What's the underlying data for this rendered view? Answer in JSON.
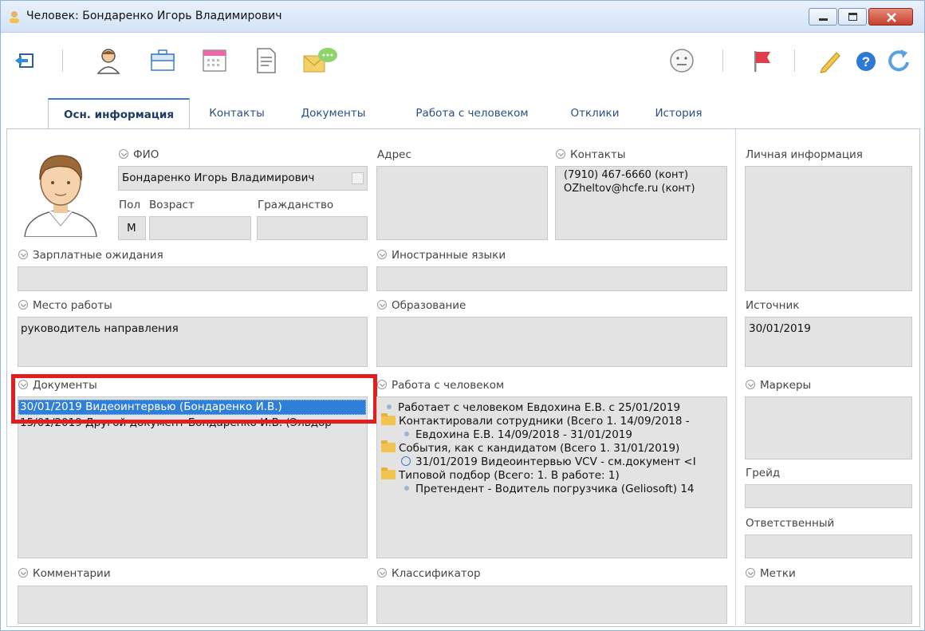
{
  "window": {
    "title": "Человек: Бондаренко Игорь Владимирович"
  },
  "tabs": [
    {
      "label": "Осн. информация",
      "active": true
    },
    {
      "label": "Контакты"
    },
    {
      "label": "Документы"
    },
    {
      "label": "Работа с человеком"
    },
    {
      "label": "Отклики"
    },
    {
      "label": "История"
    }
  ],
  "toolbar": {
    "icons": [
      "back-icon",
      "person-icon",
      "briefcase-icon",
      "calendar-icon",
      "document-icon",
      "message-icon",
      "neutral-face-icon",
      "red-flag-icon",
      "pencil-icon",
      "help-icon",
      "refresh-icon"
    ]
  },
  "person": {
    "fio_label": "ФИО",
    "fio_value": "Бондаренко Игорь Владимирович",
    "gender_label": "Пол",
    "age_label": "Возраст",
    "citizenship_label": "Гражданство",
    "gender_value": "М",
    "salary_label": "Зарплатные ожидания",
    "workplace_label": "Место работы",
    "workplace_value": "руководитель направления"
  },
  "address": {
    "label": "Адрес"
  },
  "contacts": {
    "label": "Контакты",
    "lines": [
      "(7910) 467-6660 (конт)",
      "OZheltov@hcfe.ru (конт)"
    ]
  },
  "languages": {
    "label": "Иностранные языки"
  },
  "education": {
    "label": "Образование"
  },
  "documents": {
    "label": "Документы",
    "rows": [
      "30/01/2019  Видеоинтервью (Бондаренко И.В.)",
      "15/01/2019  Другой документ Бондаренко И.В. (Эльдор"
    ]
  },
  "work": {
    "label": "Работа с человеком",
    "rows": [
      "Работает с человеком Евдохина Е.В. с 25/01/2019",
      "Контактировали сотрудники (Всего 1. 14/09/2018 -",
      "Евдохина Е.В. 14/09/2018 - 31/01/2019",
      "События, как с кандидатом (Всего 1. 31/01/2019)",
      "31/01/2019 Видеоинтервью VCV - см.документ <I",
      "Типовой подбор (Всего: 1. В работе: 1)",
      "Претендент - Водитель погрузчика (Geliosoft) 14"
    ]
  },
  "right": {
    "personal_label": "Личная информация",
    "source_label": "Источник",
    "source_value": "30/01/2019",
    "markers_label": "Маркеры",
    "grade_label": "Грейд",
    "responsible_label": "Ответственный",
    "tags_label": "Метки"
  },
  "comments": {
    "label": "Комментарии"
  },
  "classifier": {
    "label": "Классификатор"
  },
  "colors": {
    "accent": "#3d7bd0",
    "selection": "#2f7fd8",
    "highlight": "#e02020"
  }
}
